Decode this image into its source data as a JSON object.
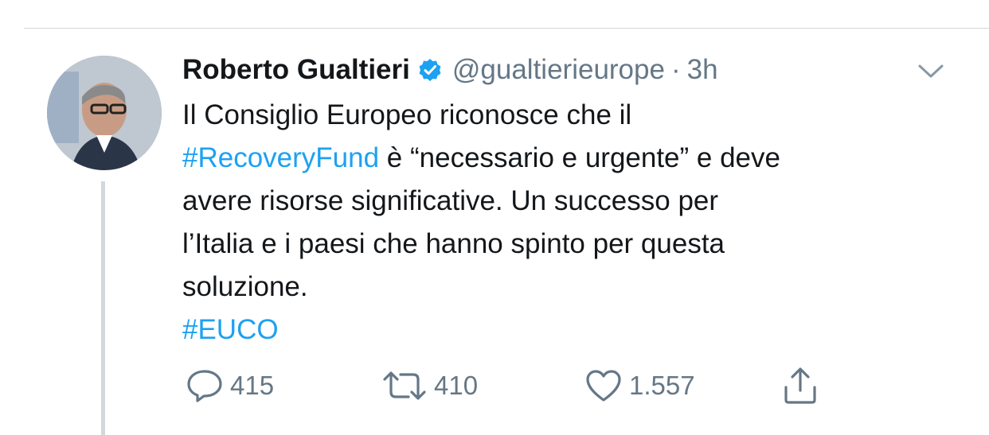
{
  "tweet": {
    "author_name": "Roberto Gualtieri",
    "handle": "@gualtierieurope",
    "separator": "·",
    "time": "3h",
    "text": {
      "line1": "Il Consiglio Europeo riconosce che il",
      "line2_hashtag": "#RecoveryFund",
      "line2_rest": " è “necessario e urgente” e deve",
      "line3": "avere risorse significative. Un successo per",
      "line4": "l’Italia e i paesi che hanno spinto per questa",
      "line5": "soluzione.",
      "line6_hashtag": "#EUCO"
    },
    "actions": {
      "replies": "415",
      "retweets": "410",
      "likes": "1.557"
    },
    "colors": {
      "link": "#1da1f2",
      "text": "#14171a",
      "secondary": "#657786",
      "verified": "#1da1f2"
    },
    "icons": [
      "verified-badge-icon",
      "chevron-down-icon",
      "reply-icon",
      "retweet-icon",
      "like-icon",
      "share-icon"
    ]
  }
}
